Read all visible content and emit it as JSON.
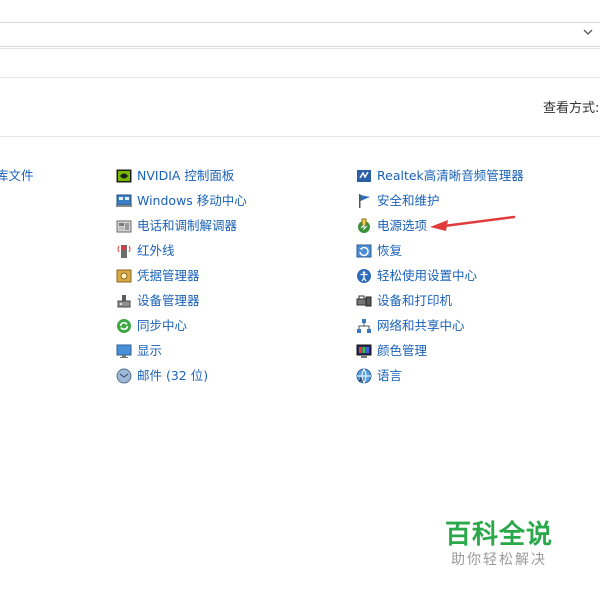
{
  "view_by": {
    "label": "查看方式:"
  },
  "left_column": [
    {
      "label": "库文件",
      "icon": "library-icon"
    }
  ],
  "middle_column": [
    {
      "label": "NVIDIA 控制面板",
      "icon": "nvidia-icon"
    },
    {
      "label": "Windows 移动中心",
      "icon": "mobility-center-icon"
    },
    {
      "label": "电话和调制解调器",
      "icon": "phone-modem-icon"
    },
    {
      "label": "红外线",
      "icon": "infrared-icon"
    },
    {
      "label": "凭据管理器",
      "icon": "credential-manager-icon"
    },
    {
      "label": "设备管理器",
      "icon": "device-manager-icon"
    },
    {
      "label": "同步中心",
      "icon": "sync-center-icon"
    },
    {
      "label": "显示",
      "icon": "display-icon"
    },
    {
      "label": "邮件 (32 位)",
      "icon": "mail-icon"
    }
  ],
  "right_column": [
    {
      "label": "Realtek高清晰音频管理器",
      "icon": "realtek-audio-icon"
    },
    {
      "label": "安全和维护",
      "icon": "security-flag-icon"
    },
    {
      "label": "电源选项",
      "icon": "power-options-icon"
    },
    {
      "label": "恢复",
      "icon": "recovery-icon"
    },
    {
      "label": "轻松使用设置中心",
      "icon": "ease-of-access-icon"
    },
    {
      "label": "设备和打印机",
      "icon": "devices-printers-icon"
    },
    {
      "label": "网络和共享中心",
      "icon": "network-sharing-icon"
    },
    {
      "label": "颜色管理",
      "icon": "color-management-icon"
    },
    {
      "label": "语言",
      "icon": "language-icon"
    }
  ],
  "watermark": {
    "title": "百科全说",
    "subtitle": "助你轻松解决"
  },
  "colors": {
    "link": "#1a62b8",
    "arrow": "#e23b3b",
    "watermark": "#2aa84a"
  }
}
